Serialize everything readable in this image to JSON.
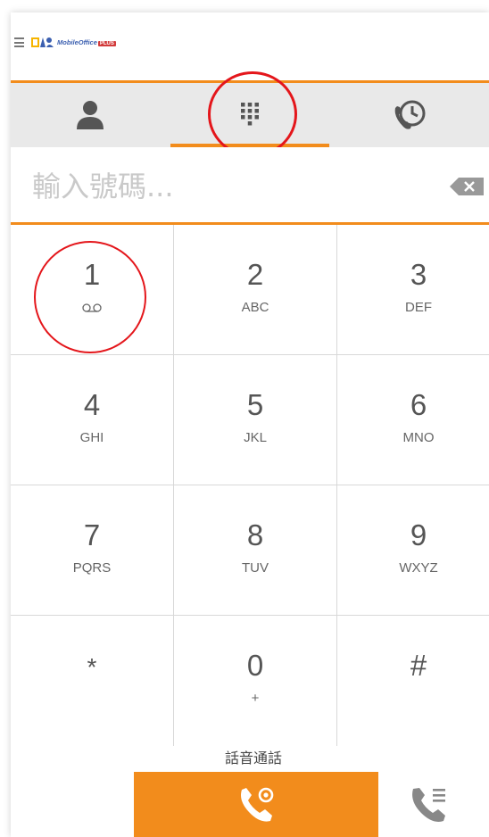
{
  "header": {
    "logo_text": "MobileOffice",
    "logo_badge": "PLUS"
  },
  "tabs": [
    {
      "name": "contacts",
      "icon": "person-icon",
      "active": false
    },
    {
      "name": "keypad",
      "icon": "dialpad-icon",
      "active": true
    },
    {
      "name": "history",
      "icon": "call-history-icon",
      "active": false
    }
  ],
  "input": {
    "placeholder": "輸入號碼...",
    "value": ""
  },
  "keypad": {
    "keys": [
      {
        "digit": "1",
        "letters": "",
        "icon": "voicemail-icon"
      },
      {
        "digit": "2",
        "letters": "ABC"
      },
      {
        "digit": "3",
        "letters": "DEF"
      },
      {
        "digit": "4",
        "letters": "GHI"
      },
      {
        "digit": "5",
        "letters": "JKL"
      },
      {
        "digit": "6",
        "letters": "MNO"
      },
      {
        "digit": "7",
        "letters": "PQRS"
      },
      {
        "digit": "8",
        "letters": "TUV"
      },
      {
        "digit": "9",
        "letters": "WXYZ"
      },
      {
        "digit": "*",
        "letters": ""
      },
      {
        "digit": "0",
        "letters": "+"
      },
      {
        "digit": "#",
        "letters": ""
      }
    ]
  },
  "call": {
    "label": "話音通話"
  },
  "colors": {
    "accent": "#f28c1c",
    "annotation": "#e4161b",
    "tab_bg": "#e9e9e9",
    "icon_gray": "#555555"
  }
}
